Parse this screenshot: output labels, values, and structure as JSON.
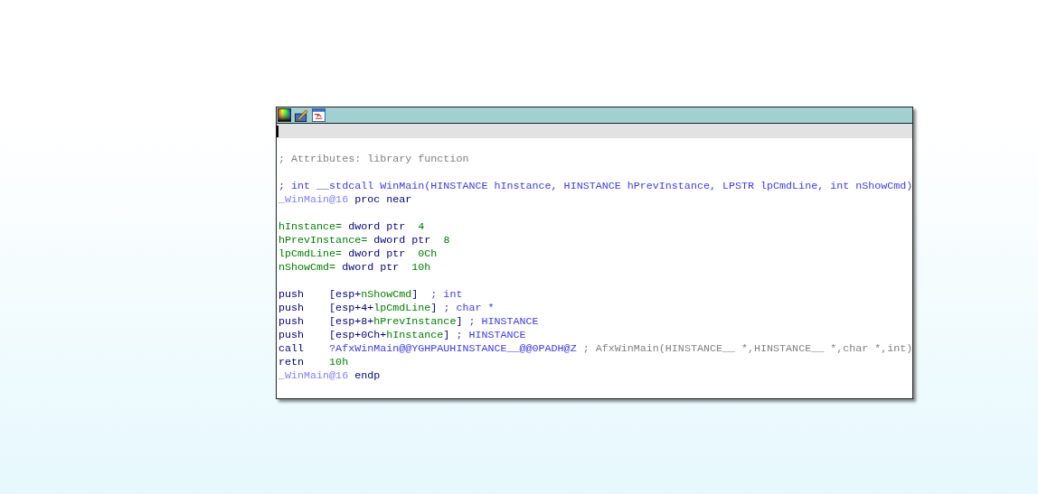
{
  "node": {
    "blocks": [
      [
        {
          "tokens": [
            {
              "text": "; Attributes: library function",
              "kind": "comment"
            }
          ]
        }
      ],
      [
        {
          "tokens": [
            {
              "text": "; int __stdcall WinMain(HINSTANCE hInstance, HINSTANCE hPrevInstance, LPSTR lpCmdLine, int nShowCmd)",
              "kind": "decl"
            }
          ]
        },
        {
          "tokens": [
            {
              "text": "_WinMain@16",
              "kind": "label"
            },
            {
              "text": " proc near",
              "kind": "keyword"
            }
          ]
        }
      ],
      [
        {
          "tokens": [
            {
              "text": "hInstance=",
              "kind": "var"
            },
            {
              "text": " dword ptr  ",
              "kind": "keyword"
            },
            {
              "text": "4",
              "kind": "number"
            }
          ]
        },
        {
          "tokens": [
            {
              "text": "hPrevInstance=",
              "kind": "var"
            },
            {
              "text": " dword ptr  ",
              "kind": "keyword"
            },
            {
              "text": "8",
              "kind": "number"
            }
          ]
        },
        {
          "tokens": [
            {
              "text": "lpCmdLine=",
              "kind": "var"
            },
            {
              "text": " dword ptr  ",
              "kind": "keyword"
            },
            {
              "text": "0Ch",
              "kind": "number"
            }
          ]
        },
        {
          "tokens": [
            {
              "text": "nShowCmd=",
              "kind": "var"
            },
            {
              "text": " dword ptr  ",
              "kind": "keyword"
            },
            {
              "text": "10h",
              "kind": "number"
            }
          ]
        }
      ],
      [
        {
          "tokens": [
            {
              "text": "push    [esp+",
              "kind": "keyword"
            },
            {
              "text": "nShowCmd",
              "kind": "var"
            },
            {
              "text": "]  ",
              "kind": "keyword"
            },
            {
              "text": "; int",
              "kind": "decl"
            }
          ]
        },
        {
          "tokens": [
            {
              "text": "push    [esp+4+",
              "kind": "keyword"
            },
            {
              "text": "lpCmdLine",
              "kind": "var"
            },
            {
              "text": "] ",
              "kind": "keyword"
            },
            {
              "text": "; char *",
              "kind": "decl"
            }
          ]
        },
        {
          "tokens": [
            {
              "text": "push    [esp+8+",
              "kind": "keyword"
            },
            {
              "text": "hPrevInstance",
              "kind": "var"
            },
            {
              "text": "] ",
              "kind": "keyword"
            },
            {
              "text": "; HINSTANCE",
              "kind": "decl"
            }
          ]
        },
        {
          "tokens": [
            {
              "text": "push    [esp+0Ch+",
              "kind": "keyword"
            },
            {
              "text": "hInstance",
              "kind": "var"
            },
            {
              "text": "] ",
              "kind": "keyword"
            },
            {
              "text": "; HINSTANCE",
              "kind": "decl"
            }
          ]
        },
        {
          "tokens": [
            {
              "text": "call    ",
              "kind": "keyword"
            },
            {
              "text": "?AfxWinMain@@YGHPAUHINSTANCE__@@0PADH@Z",
              "kind": "decl"
            },
            {
              "text": " ; AfxWinMain(HINSTANCE__ *,HINSTANCE__ *,char *,int)",
              "kind": "comment"
            }
          ]
        },
        {
          "tokens": [
            {
              "text": "retn    ",
              "kind": "keyword"
            },
            {
              "text": "10h",
              "kind": "number"
            }
          ]
        },
        {
          "tokens": [
            {
              "text": "_WinMain@16",
              "kind": "label"
            },
            {
              "text": " endp",
              "kind": "keyword"
            }
          ]
        }
      ]
    ]
  }
}
